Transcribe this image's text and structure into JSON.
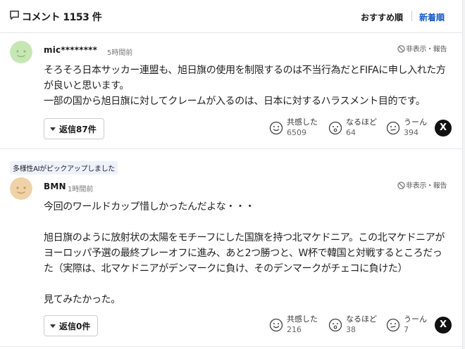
{
  "header": {
    "title": "コメント 1153 件",
    "sort_recommended": "おすすめ順",
    "sort_newest": "新着順"
  },
  "comments": [
    {
      "username": "mic********",
      "time": "5時間前",
      "report_label": "非表示・報告",
      "body": [
        "そろそろ日本サッカー連盟も、旭日旗の使用を制限するのは不当行為だとFIFAに申し入れた方が良いと思います。",
        "一部の国から旭日旗に対してクレームが入るのは、日本に対するハラスメント目的です。"
      ],
      "reply_label": "返信87件",
      "reactions": [
        {
          "label": "共感した",
          "count": "6509"
        },
        {
          "label": "なるほど",
          "count": "64"
        },
        {
          "label": "うーん",
          "count": "394"
        }
      ],
      "avatar_color": "#c6e6b3"
    },
    {
      "badge": "多様性AIがピックアップしました",
      "username": "BMN",
      "time": "1時間前",
      "report_label": "非表示・報告",
      "body": [
        "今回のワールドカップ惜しかったんだよな・・・",
        "",
        "旭日旗のように放射状の太陽をモチーフにした国旗を持つ北マケドニア。この北マケドニアがヨーロッパ予選の最終プレーオフに進み、あと2つ勝つと、W杯で韓国と対戦するところだった（実際は、北マケドニアがデンマークに負け、そのデンマークがチェコに負けた）",
        "",
        "見てみたかった。"
      ],
      "reply_label": "返信0件",
      "reactions": [
        {
          "label": "共感した",
          "count": "216"
        },
        {
          "label": "なるほど",
          "count": "38"
        },
        {
          "label": "うーん",
          "count": "7"
        }
      ],
      "avatar_color": "#f0d2a8"
    }
  ],
  "share_label": "X"
}
